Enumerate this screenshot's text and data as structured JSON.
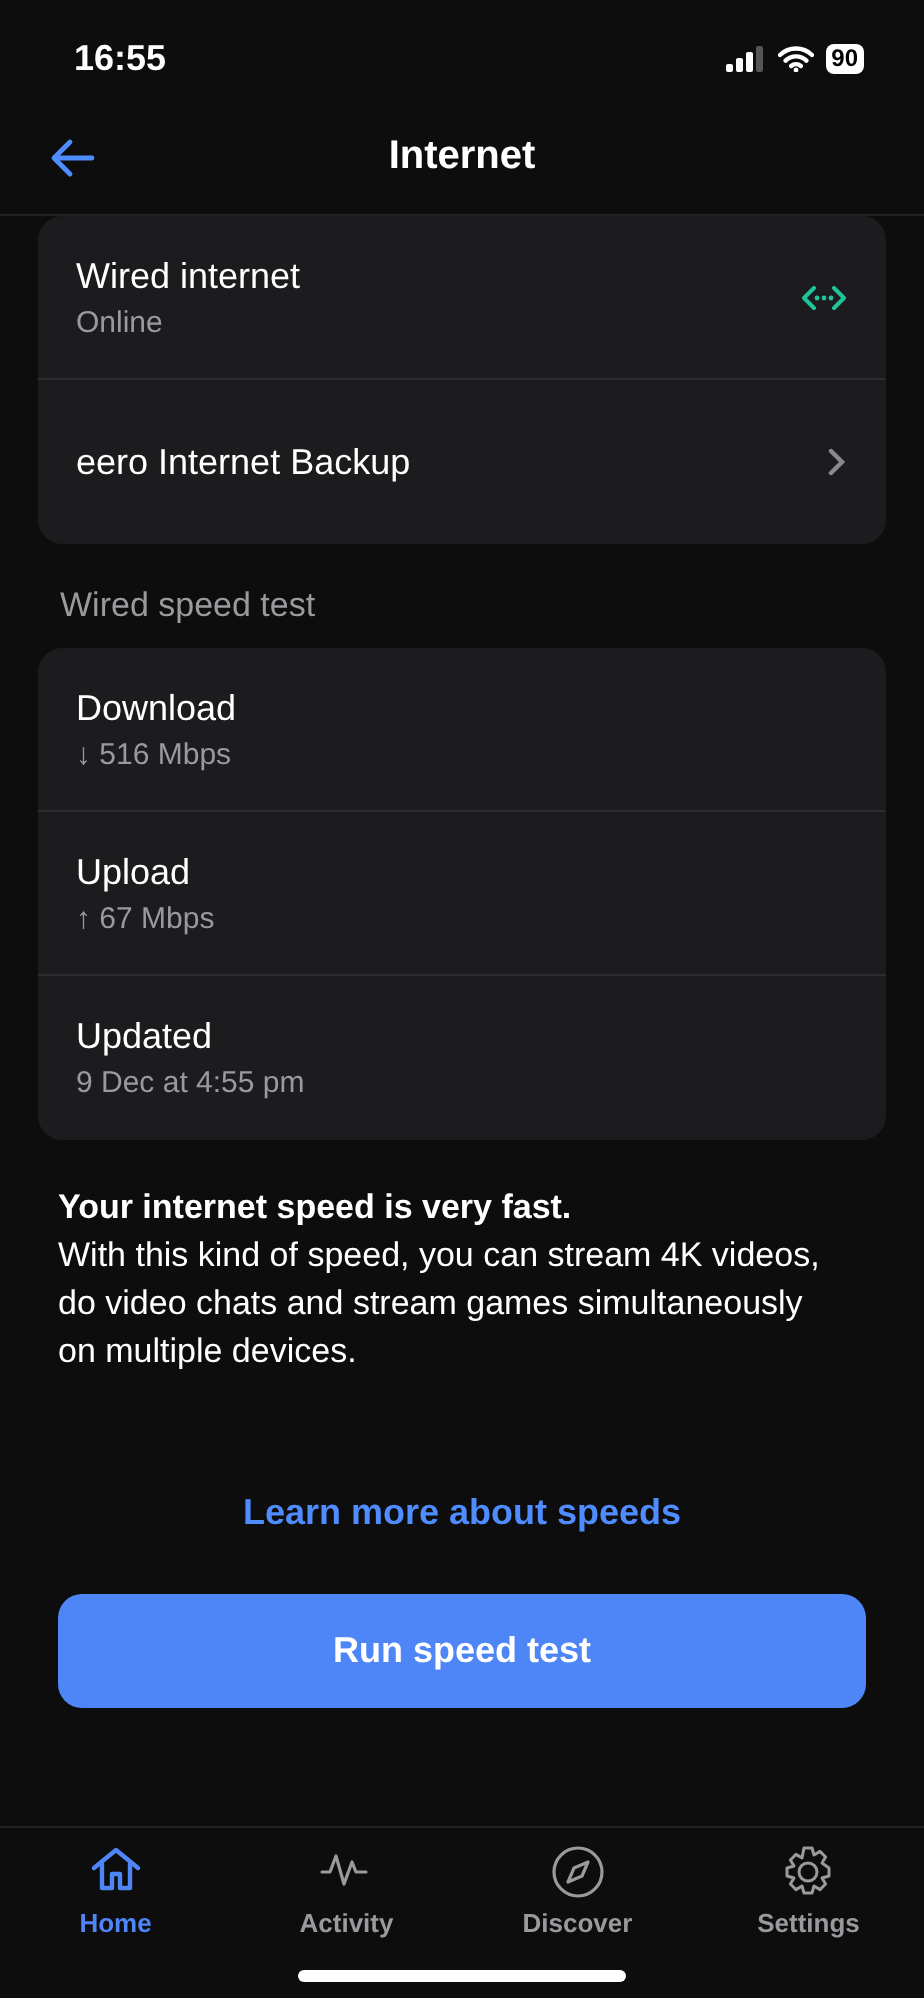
{
  "status_bar": {
    "time": "16:55",
    "battery": "90"
  },
  "header": {
    "title": "Internet"
  },
  "connection": [
    {
      "kind": "status",
      "title": "Wired internet",
      "subtitle": "Online"
    },
    {
      "kind": "link",
      "title": "eero Internet Backup"
    }
  ],
  "speed_test": {
    "label": "Wired speed test",
    "rows": [
      {
        "title": "Download",
        "value": "↓ 516 Mbps"
      },
      {
        "title": "Upload",
        "value": "↑ 67 Mbps"
      },
      {
        "title": "Updated",
        "value": "9 Dec at 4:55 pm"
      }
    ]
  },
  "summary": {
    "heading": "Your internet speed is very fast.",
    "body": "With this kind of speed, you can stream 4K videos, do video chats and stream games simultaneously on multiple devices."
  },
  "learn_link": "Learn more about speeds",
  "run_button": "Run speed test",
  "tabs": [
    {
      "label": "Home",
      "kind": "home",
      "selected": true
    },
    {
      "label": "Activity",
      "kind": "activity",
      "selected": false
    },
    {
      "label": "Discover",
      "kind": "discover",
      "selected": false
    },
    {
      "label": "Settings",
      "kind": "settings",
      "selected": false
    }
  ]
}
